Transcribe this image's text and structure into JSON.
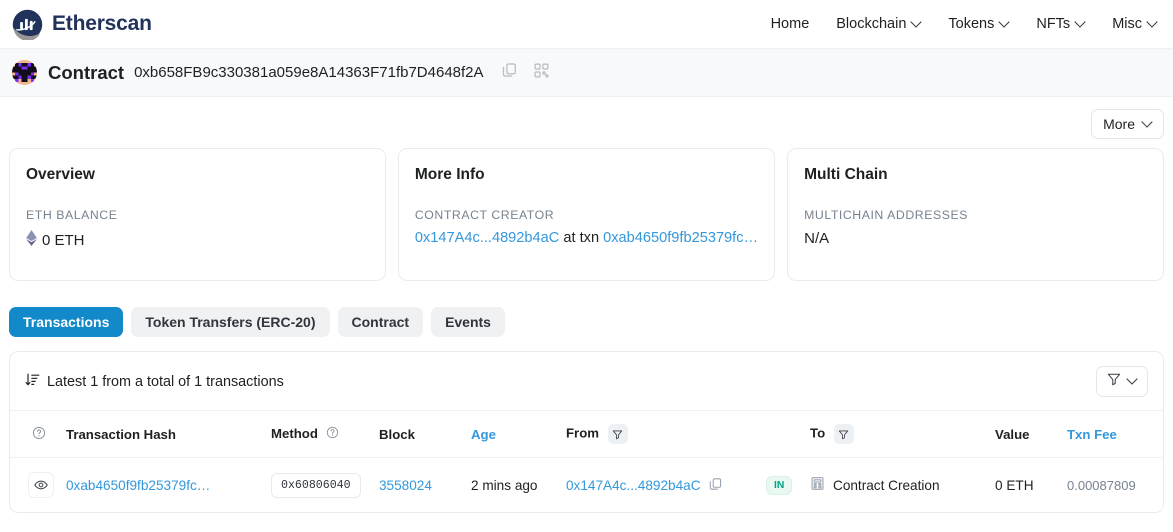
{
  "brand": {
    "name": "Etherscan",
    "logo_icon": "etherscan-logo-icon"
  },
  "nav": {
    "items": [
      {
        "label": "Home",
        "has_caret": false
      },
      {
        "label": "Blockchain",
        "has_caret": true
      },
      {
        "label": "Tokens",
        "has_caret": true
      },
      {
        "label": "NFTs",
        "has_caret": true
      },
      {
        "label": "Misc",
        "has_caret": true
      }
    ]
  },
  "title_bar": {
    "label": "Contract",
    "address": "0xb658FB9c330381a059e8A14363F71fb7D4648f2A",
    "copy_icon": "copy-icon",
    "qr_icon": "qr-code-icon",
    "avatar_icon": "address-identicon"
  },
  "toolbar": {
    "more_label": "More"
  },
  "cards": {
    "overview": {
      "title": "Overview",
      "sub_label": "ETH BALANCE",
      "value": "0 ETH",
      "eth_icon": "ethereum-diamond-icon"
    },
    "more_info": {
      "title": "More Info",
      "sub_label": "CONTRACT CREATOR",
      "creator_address": "0x147A4c...4892b4aC",
      "connector": "at txn",
      "creation_txn": "0xab4650f9fb25379fc…"
    },
    "multi_chain": {
      "title": "Multi Chain",
      "sub_label": "MULTICHAIN ADDRESSES",
      "value": "N/A"
    }
  },
  "tabs": [
    {
      "label": "Transactions",
      "active": true
    },
    {
      "label": "Token Transfers (ERC-20)",
      "active": false
    },
    {
      "label": "Contract",
      "active": false
    },
    {
      "label": "Events",
      "active": false
    }
  ],
  "transactions_panel": {
    "summary": "Latest 1 from a total of 1 transactions",
    "sort_icon": "sort-descending-icon",
    "filter_icon": "funnel-filter-icon",
    "columns": {
      "help": "",
      "hash": "Transaction Hash",
      "method": "Method",
      "block": "Block",
      "age": "Age",
      "from": "From",
      "to": "To",
      "value": "Value",
      "fee": "Txn Fee"
    },
    "rows": [
      {
        "eye_icon": "eye-icon",
        "hash": "0xab4650f9fb25379fc…",
        "method": "0x60806040",
        "block": "3558024",
        "age": "2 mins ago",
        "from": "0x147A4c...4892b4aC",
        "from_copy_icon": "copy-icon",
        "direction": "IN",
        "to_icon": "contract-icon",
        "to": "Contract Creation",
        "value": "0 ETH",
        "fee": "0.00087809"
      }
    ]
  },
  "colors": {
    "brand_navy": "#21325b",
    "link_blue": "#3498db",
    "tab_active_blue": "#1289c9",
    "in_badge_green": "#00a186",
    "muted_gray": "#77838f"
  }
}
